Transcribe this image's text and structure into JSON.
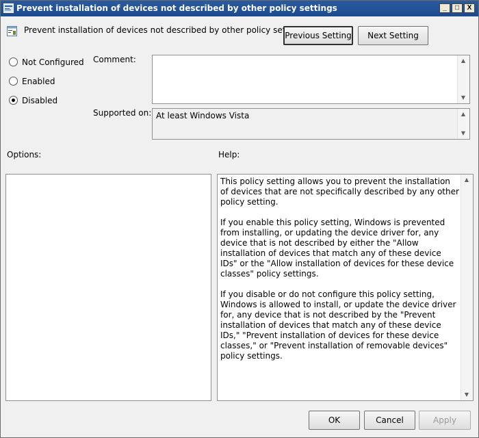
{
  "window": {
    "title": "Prevent installation of devices not described by other policy settings",
    "minimize_glyph": "_",
    "maximize_glyph": "□",
    "close_glyph": "X"
  },
  "header": {
    "policy_title": "Prevent installation of devices not described by other policy settings",
    "previous_label": "Previous Setting",
    "next_label": "Next Setting"
  },
  "state": {
    "options": [
      {
        "label": "Not Configured",
        "selected": false
      },
      {
        "label": "Enabled",
        "selected": false
      },
      {
        "label": "Disabled",
        "selected": true
      }
    ]
  },
  "comment": {
    "label": "Comment:",
    "value": ""
  },
  "supported": {
    "label": "Supported on:",
    "value": "At least Windows Vista"
  },
  "options_panel": {
    "label": "Options:"
  },
  "help": {
    "label": "Help:",
    "paragraphs": [
      "This policy setting allows you to prevent the installation of devices that are not specifically described by any other policy setting.",
      "If you enable this policy setting, Windows is prevented from installing, or updating the device driver for, any device that is not described by either the \"Allow installation of devices that match any of these device IDs\" or the \"Allow installation of devices for these device classes\" policy settings.",
      "If you disable or do not configure this policy setting, Windows is allowed to install, or update the device driver for, any device that is not described by the \"Prevent installation of devices that match any of these device IDs,\" \"Prevent installation of devices for these device classes,\" or \"Prevent installation of removable devices\" policy settings."
    ]
  },
  "footer": {
    "ok_label": "OK",
    "cancel_label": "Cancel",
    "apply_label": "Apply"
  }
}
